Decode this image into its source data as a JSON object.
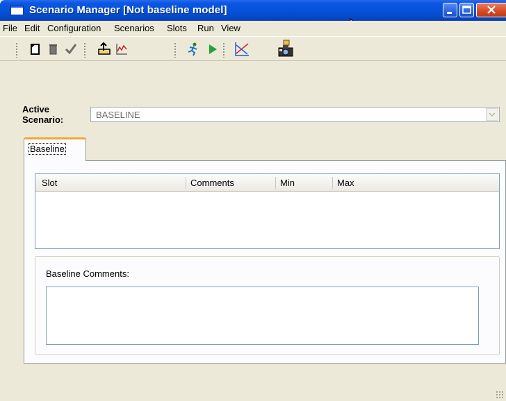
{
  "window": {
    "title": "Scenario Manager [Not baseline model]"
  },
  "menubar": {
    "items": [
      "File",
      "Edit",
      "Configuration",
      "Scenarios",
      "Slots",
      "Run",
      "View"
    ]
  },
  "toolbar": {
    "icons": [
      "new-icon",
      "delete-icon",
      "checkmark-icon",
      "export-icon",
      "chart-icon",
      "runner-icon",
      "play-icon",
      "plot-icon",
      "camera-icon"
    ]
  },
  "active_scenario": {
    "label_line1": "Active",
    "label_line2": "Scenario:",
    "value": "BASELINE"
  },
  "tabs": [
    {
      "label": "Baseline"
    }
  ],
  "slots_table": {
    "columns": [
      "Slot",
      "Comments",
      "Min",
      "Max"
    ],
    "rows": []
  },
  "baseline_comments": {
    "label": "Baseline Comments:",
    "value": ""
  },
  "colors": {
    "title_bar": "#0652d8",
    "tab_accent": "#f1a733",
    "window_bg": "#ece9d8",
    "close_button": "#d54a26"
  }
}
